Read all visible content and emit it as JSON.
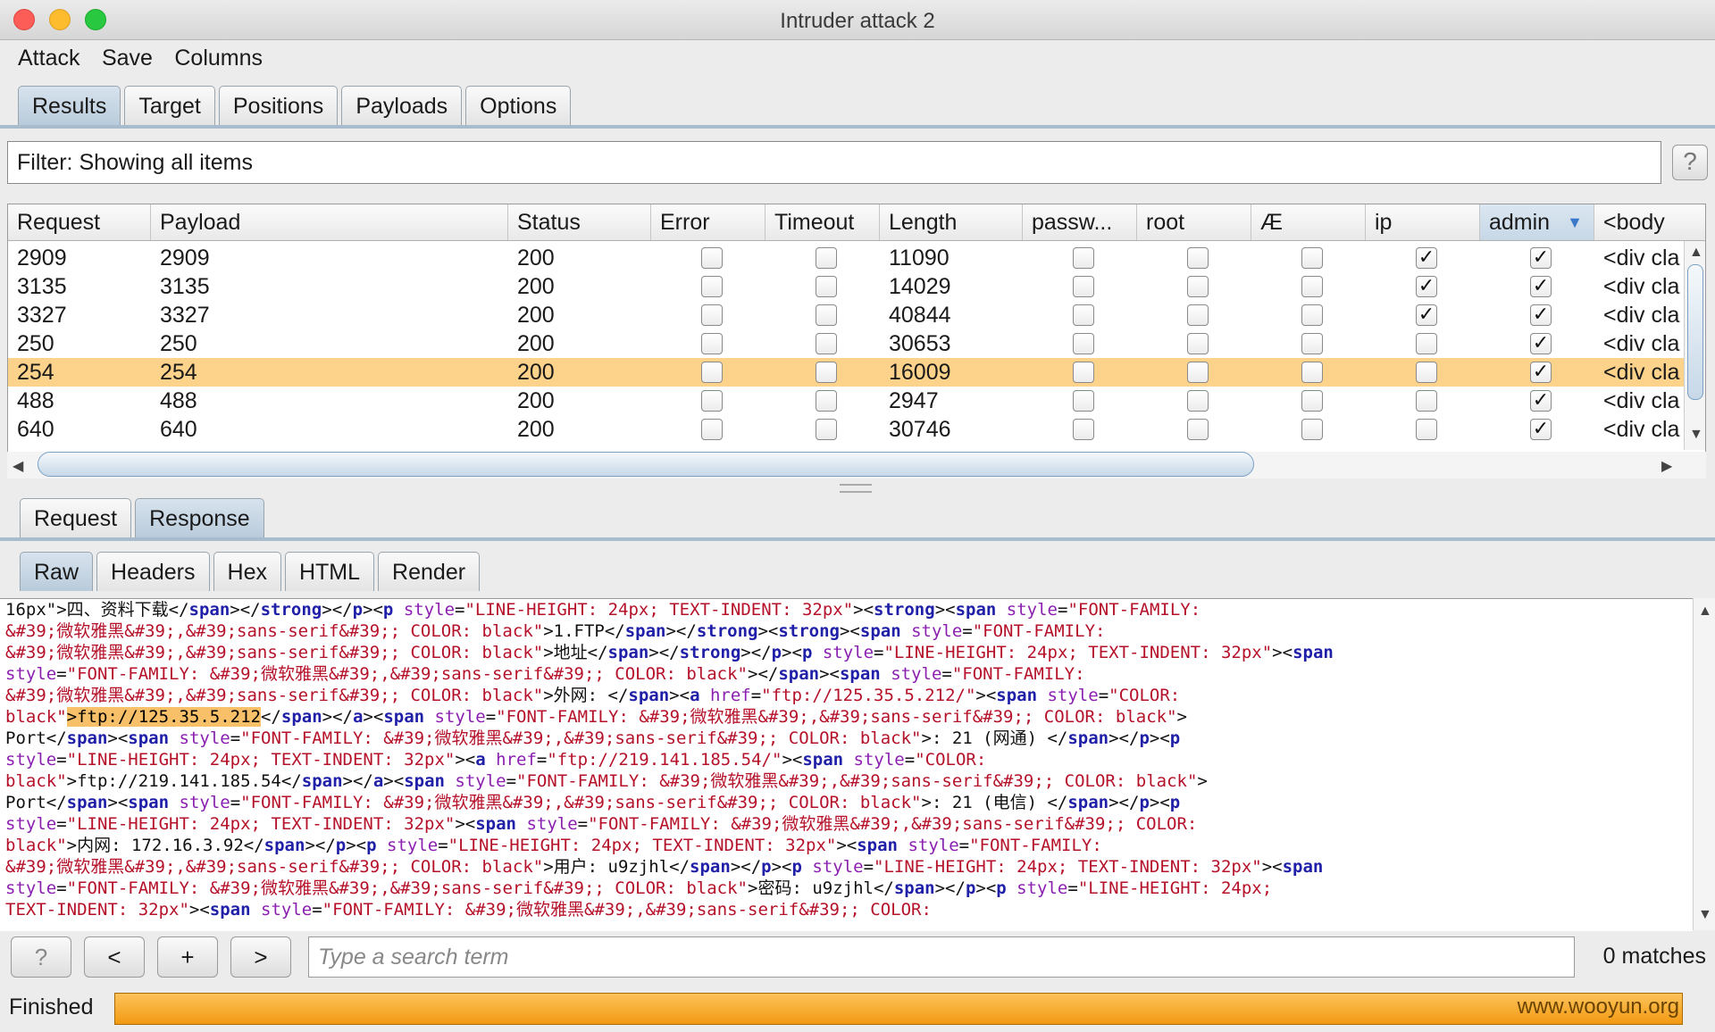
{
  "window": {
    "title": "Intruder attack 2"
  },
  "menu": [
    "Attack",
    "Save",
    "Columns"
  ],
  "main_tabs": [
    {
      "label": "Results",
      "active": true
    },
    {
      "label": "Target",
      "active": false
    },
    {
      "label": "Positions",
      "active": false
    },
    {
      "label": "Payloads",
      "active": false
    },
    {
      "label": "Options",
      "active": false
    }
  ],
  "filter": {
    "text": "Filter: Showing all items",
    "help": "?"
  },
  "table": {
    "columns": [
      "Request",
      "Payload",
      "Status",
      "Error",
      "Timeout",
      "Length",
      "passw...",
      "root",
      "Æ",
      "ip",
      "admin",
      "<body"
    ],
    "sorted_column": "admin",
    "rows": [
      {
        "request": "2909",
        "payload": "2909",
        "status": "200",
        "error": false,
        "timeout": false,
        "length": "11090",
        "passw": false,
        "root": false,
        "ae": false,
        "ip": true,
        "admin": true,
        "body": "<div cla"
      },
      {
        "request": "3135",
        "payload": "3135",
        "status": "200",
        "error": false,
        "timeout": false,
        "length": "14029",
        "passw": false,
        "root": false,
        "ae": false,
        "ip": true,
        "admin": true,
        "body": "<div cla"
      },
      {
        "request": "3327",
        "payload": "3327",
        "status": "200",
        "error": false,
        "timeout": false,
        "length": "40844",
        "passw": false,
        "root": false,
        "ae": false,
        "ip": true,
        "admin": true,
        "body": "<div cla"
      },
      {
        "request": "250",
        "payload": "250",
        "status": "200",
        "error": false,
        "timeout": false,
        "length": "30653",
        "passw": false,
        "root": false,
        "ae": false,
        "ip": false,
        "admin": true,
        "body": "<div cla"
      },
      {
        "request": "254",
        "payload": "254",
        "status": "200",
        "error": false,
        "timeout": false,
        "length": "16009",
        "passw": false,
        "root": false,
        "ae": false,
        "ip": false,
        "admin": true,
        "body": "<div cla",
        "selected": true
      },
      {
        "request": "488",
        "payload": "488",
        "status": "200",
        "error": false,
        "timeout": false,
        "length": "2947",
        "passw": false,
        "root": false,
        "ae": false,
        "ip": false,
        "admin": true,
        "body": "<div cla"
      },
      {
        "request": "640",
        "payload": "640",
        "status": "200",
        "error": false,
        "timeout": false,
        "length": "30746",
        "passw": false,
        "root": false,
        "ae": false,
        "ip": false,
        "admin": true,
        "body": "<div cla"
      }
    ]
  },
  "detail_tabs": [
    {
      "label": "Request",
      "active": false
    },
    {
      "label": "Response",
      "active": true
    }
  ],
  "view_tabs": [
    {
      "label": "Raw",
      "active": true
    },
    {
      "label": "Headers",
      "active": false
    },
    {
      "label": "Hex",
      "active": false
    },
    {
      "label": "HTML",
      "active": false
    },
    {
      "label": "Render",
      "active": false
    }
  ],
  "response_lines": [
    [
      [
        "k",
        "16px\">四、资料下载</"
      ],
      [
        "t",
        "span"
      ],
      [
        "k",
        "></"
      ],
      [
        "t",
        "strong"
      ],
      [
        "k",
        "></"
      ],
      [
        "t",
        "p"
      ],
      [
        "k",
        "><"
      ],
      [
        "t",
        "p "
      ],
      [
        "a",
        "style"
      ],
      [
        "k",
        "="
      ],
      [
        "v",
        "\"LINE-HEIGHT: 24px; TEXT-INDENT: 32px\""
      ],
      [
        "k",
        "><"
      ],
      [
        "t",
        "strong"
      ],
      [
        "k",
        "><"
      ],
      [
        "t",
        "span "
      ],
      [
        "a",
        "style"
      ],
      [
        "k",
        "="
      ],
      [
        "v",
        "\"FONT-FAMILY:"
      ]
    ],
    [
      [
        "v",
        "&#39;微软雅黑&#39;,&#39;sans-serif&#39;; COLOR: black\""
      ],
      [
        "k",
        ">1.FTP</"
      ],
      [
        "t",
        "span"
      ],
      [
        "k",
        "></"
      ],
      [
        "t",
        "strong"
      ],
      [
        "k",
        "><"
      ],
      [
        "t",
        "strong"
      ],
      [
        "k",
        "><"
      ],
      [
        "t",
        "span "
      ],
      [
        "a",
        "style"
      ],
      [
        "k",
        "="
      ],
      [
        "v",
        "\"FONT-FAMILY:"
      ]
    ],
    [
      [
        "v",
        "&#39;微软雅黑&#39;,&#39;sans-serif&#39;; COLOR: black\""
      ],
      [
        "k",
        ">地址</"
      ],
      [
        "t",
        "span"
      ],
      [
        "k",
        "></"
      ],
      [
        "t",
        "strong"
      ],
      [
        "k",
        "></"
      ],
      [
        "t",
        "p"
      ],
      [
        "k",
        "><"
      ],
      [
        "t",
        "p "
      ],
      [
        "a",
        "style"
      ],
      [
        "k",
        "="
      ],
      [
        "v",
        "\"LINE-HEIGHT: 24px; TEXT-INDENT: 32px\""
      ],
      [
        "k",
        "><"
      ],
      [
        "t",
        "span"
      ]
    ],
    [
      [
        "a",
        "style"
      ],
      [
        "k",
        "="
      ],
      [
        "v",
        "\"FONT-FAMILY: &#39;微软雅黑&#39;,&#39;sans-serif&#39;; COLOR: black\""
      ],
      [
        "k",
        "></"
      ],
      [
        "t",
        "span"
      ],
      [
        "k",
        "><"
      ],
      [
        "t",
        "span "
      ],
      [
        "a",
        "style"
      ],
      [
        "k",
        "="
      ],
      [
        "v",
        "\"FONT-FAMILY:"
      ]
    ],
    [
      [
        "v",
        "&#39;微软雅黑&#39;,&#39;sans-serif&#39;; COLOR: black\""
      ],
      [
        "k",
        ">外网: </"
      ],
      [
        "t",
        "span"
      ],
      [
        "k",
        "><"
      ],
      [
        "t",
        "a "
      ],
      [
        "a",
        "href"
      ],
      [
        "k",
        "="
      ],
      [
        "v",
        "\"ftp://125.35.5.212/\""
      ],
      [
        "k",
        "><"
      ],
      [
        "t",
        "span "
      ],
      [
        "a",
        "style"
      ],
      [
        "k",
        "="
      ],
      [
        "v",
        "\"COLOR:"
      ]
    ],
    [
      [
        "v",
        "black\""
      ],
      [
        "hl",
        ">ftp://125.35.5.212"
      ],
      [
        "k",
        "</"
      ],
      [
        "t",
        "span"
      ],
      [
        "k",
        "></"
      ],
      [
        "t",
        "a"
      ],
      [
        "k",
        "><"
      ],
      [
        "t",
        "span "
      ],
      [
        "a",
        "style"
      ],
      [
        "k",
        "="
      ],
      [
        "v",
        "\"FONT-FAMILY: &#39;微软雅黑&#39;,&#39;sans-serif&#39;; COLOR: black\""
      ],
      [
        "k",
        ">"
      ]
    ],
    [
      [
        "k",
        "Port</"
      ],
      [
        "t",
        "span"
      ],
      [
        "k",
        "><"
      ],
      [
        "t",
        "span "
      ],
      [
        "a",
        "style"
      ],
      [
        "k",
        "="
      ],
      [
        "v",
        "\"FONT-FAMILY: &#39;微软雅黑&#39;,&#39;sans-serif&#39;; COLOR: black\""
      ],
      [
        "k",
        ">: 21 (网通) </"
      ],
      [
        "t",
        "span"
      ],
      [
        "k",
        "></"
      ],
      [
        "t",
        "p"
      ],
      [
        "k",
        "><"
      ],
      [
        "t",
        "p"
      ]
    ],
    [
      [
        "a",
        "style"
      ],
      [
        "k",
        "="
      ],
      [
        "v",
        "\"LINE-HEIGHT: 24px; TEXT-INDENT: 32px\""
      ],
      [
        "k",
        "><"
      ],
      [
        "t",
        "a "
      ],
      [
        "a",
        "href"
      ],
      [
        "k",
        "="
      ],
      [
        "v",
        "\"ftp://219.141.185.54/\""
      ],
      [
        "k",
        "><"
      ],
      [
        "t",
        "span "
      ],
      [
        "a",
        "style"
      ],
      [
        "k",
        "="
      ],
      [
        "v",
        "\"COLOR:"
      ]
    ],
    [
      [
        "v",
        "black\""
      ],
      [
        "k",
        ">ftp://219.141.185.54</"
      ],
      [
        "t",
        "span"
      ],
      [
        "k",
        "></"
      ],
      [
        "t",
        "a"
      ],
      [
        "k",
        "><"
      ],
      [
        "t",
        "span "
      ],
      [
        "a",
        "style"
      ],
      [
        "k",
        "="
      ],
      [
        "v",
        "\"FONT-FAMILY: &#39;微软雅黑&#39;,&#39;sans-serif&#39;; COLOR: black\""
      ],
      [
        "k",
        ">"
      ]
    ],
    [
      [
        "k",
        "Port</"
      ],
      [
        "t",
        "span"
      ],
      [
        "k",
        "><"
      ],
      [
        "t",
        "span "
      ],
      [
        "a",
        "style"
      ],
      [
        "k",
        "="
      ],
      [
        "v",
        "\"FONT-FAMILY: &#39;微软雅黑&#39;,&#39;sans-serif&#39;; COLOR: black\""
      ],
      [
        "k",
        ">: 21 (电信) </"
      ],
      [
        "t",
        "span"
      ],
      [
        "k",
        "></"
      ],
      [
        "t",
        "p"
      ],
      [
        "k",
        "><"
      ],
      [
        "t",
        "p"
      ]
    ],
    [
      [
        "a",
        "style"
      ],
      [
        "k",
        "="
      ],
      [
        "v",
        "\"LINE-HEIGHT: 24px; TEXT-INDENT: 32px\""
      ],
      [
        "k",
        "><"
      ],
      [
        "t",
        "span "
      ],
      [
        "a",
        "style"
      ],
      [
        "k",
        "="
      ],
      [
        "v",
        "\"FONT-FAMILY: &#39;微软雅黑&#39;,&#39;sans-serif&#39;; COLOR:"
      ]
    ],
    [
      [
        "v",
        "black\""
      ],
      [
        "k",
        ">内网: 172.16.3.92</"
      ],
      [
        "t",
        "span"
      ],
      [
        "k",
        "></"
      ],
      [
        "t",
        "p"
      ],
      [
        "k",
        "><"
      ],
      [
        "t",
        "p "
      ],
      [
        "a",
        "style"
      ],
      [
        "k",
        "="
      ],
      [
        "v",
        "\"LINE-HEIGHT: 24px; TEXT-INDENT: 32px\""
      ],
      [
        "k",
        "><"
      ],
      [
        "t",
        "span "
      ],
      [
        "a",
        "style"
      ],
      [
        "k",
        "="
      ],
      [
        "v",
        "\"FONT-FAMILY:"
      ]
    ],
    [
      [
        "v",
        "&#39;微软雅黑&#39;,&#39;sans-serif&#39;; COLOR: black\""
      ],
      [
        "k",
        ">用户: u9zjhl</"
      ],
      [
        "t",
        "span"
      ],
      [
        "k",
        "></"
      ],
      [
        "t",
        "p"
      ],
      [
        "k",
        "><"
      ],
      [
        "t",
        "p "
      ],
      [
        "a",
        "style"
      ],
      [
        "k",
        "="
      ],
      [
        "v",
        "\"LINE-HEIGHT: 24px; TEXT-INDENT: 32px\""
      ],
      [
        "k",
        "><"
      ],
      [
        "t",
        "span"
      ]
    ],
    [
      [
        "a",
        "style"
      ],
      [
        "k",
        "="
      ],
      [
        "v",
        "\"FONT-FAMILY: &#39;微软雅黑&#39;,&#39;sans-serif&#39;; COLOR: black\""
      ],
      [
        "k",
        ">密码: u9zjhl</"
      ],
      [
        "t",
        "span"
      ],
      [
        "k",
        "></"
      ],
      [
        "t",
        "p"
      ],
      [
        "k",
        "><"
      ],
      [
        "t",
        "p "
      ],
      [
        "a",
        "style"
      ],
      [
        "k",
        "="
      ],
      [
        "v",
        "\"LINE-HEIGHT: 24px;"
      ]
    ],
    [
      [
        "v",
        "TEXT-INDENT: 32px\""
      ],
      [
        "k",
        "><"
      ],
      [
        "t",
        "span "
      ],
      [
        "a",
        "style"
      ],
      [
        "k",
        "="
      ],
      [
        "v",
        "\"FONT-FAMILY: &#39;微软雅黑&#39;,&#39;sans-serif&#39;; COLOR:"
      ]
    ]
  ],
  "search": {
    "placeholder": "Type a search term",
    "matches": "0 matches",
    "help": "?",
    "prev": "<",
    "add": "+",
    "next": ">"
  },
  "status": {
    "text": "Finished",
    "progress": 1.0,
    "watermark": "www.wooyun.org"
  }
}
